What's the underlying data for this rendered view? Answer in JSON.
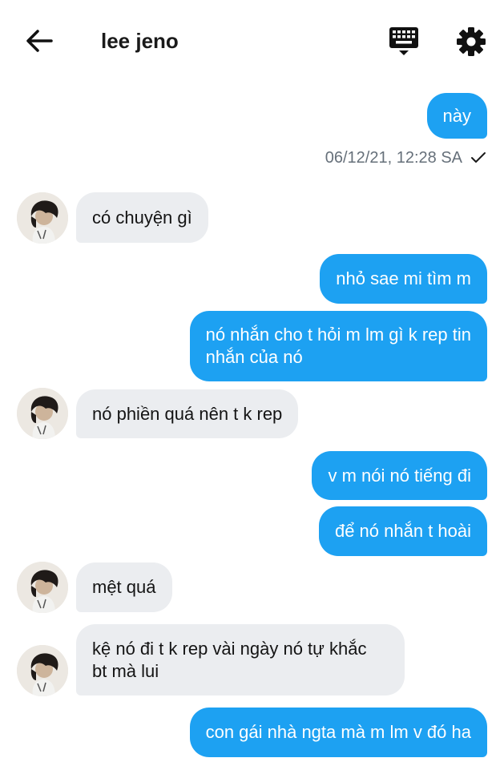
{
  "header": {
    "title": "lee jeno",
    "back_icon": "arrow-left-icon",
    "keyboard_icon": "keyboard-icon",
    "settings_icon": "gear-icon"
  },
  "colors": {
    "sent_bubble": "#1da1f2",
    "received_bubble": "#ebedf0",
    "timestamp_text": "#66707a"
  },
  "messages": [
    {
      "from": "me",
      "text": "này"
    },
    {
      "from": "them",
      "text": "có chuyện gì"
    },
    {
      "from": "me",
      "text": "nhỏ sae mi tìm m"
    },
    {
      "from": "me",
      "text": "nó nhắn cho t hỏi m lm gì k rep tin\nnhắn của nó"
    },
    {
      "from": "them",
      "text": "nó phiền quá nên t k rep"
    },
    {
      "from": "me",
      "text": "v m nói nó tiếng đi"
    },
    {
      "from": "me",
      "text": "để nó nhắn t hoài"
    },
    {
      "from": "them",
      "text": "mệt quá"
    },
    {
      "from": "them",
      "text": "kệ nó đi t k rep vài ngày nó tự khắc\nbt mà lui"
    },
    {
      "from": "me",
      "text": "con gái nhà ngta mà m lm v đó ha"
    }
  ],
  "timestamp": {
    "text": "06/12/21, 12:28 SA",
    "check_icon": "checkmark-icon"
  }
}
